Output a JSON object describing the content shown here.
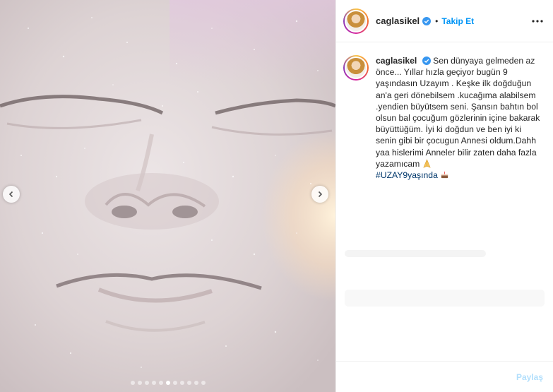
{
  "header": {
    "username": "caglasikel",
    "separator": "•",
    "follow_label": "Takip Et"
  },
  "caption": {
    "username": "caglasikel",
    "text": "Sen dünyaya gelmeden az önce... Yıllar hızla geçiyor bugün 9 yaşındasın Uzayım . Keşke ilk doğduğun an'a geri dönebilsem .kucağıma alabilsem .yendien büyütsem seni. Şansın bahtın bol olsun bal çocuğum gözlerinin içine bakarak büyüttüğüm. İyi ki doğdun ve ben iyi ki senin gibi bir çocugun Annesi oldum.Dahh yaa hislerimi Anneler bilir zaten daha fazla yazamıcam",
    "hashtag": "#UZAY9yaşında"
  },
  "comment_bar": {
    "post_label": "Paylaş"
  },
  "carousel": {
    "dot_count": 11,
    "active_index": 5
  },
  "colors": {
    "accent": "#0095f6",
    "hashtag": "#00376b",
    "verified": "#3897f0"
  },
  "icons": {
    "prev": "chevron-left-icon",
    "next": "chevron-right-icon",
    "more": "more-options-icon",
    "verified": "verified-badge-icon",
    "praying_hands": "praying-hands-emoji",
    "cake": "cake-emoji"
  }
}
